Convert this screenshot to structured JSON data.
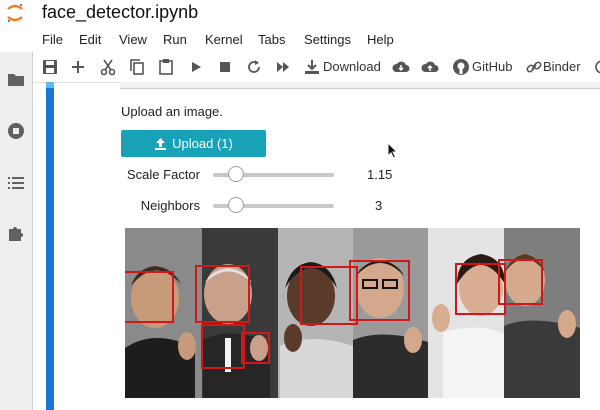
{
  "app": {
    "notebook_title": "face_detector.ipynb"
  },
  "menu": [
    "File",
    "Edit",
    "View",
    "Run",
    "Kernel",
    "Tabs",
    "Settings",
    "Help"
  ],
  "toolbar": {
    "download_label": "Download",
    "github_label": "GitHub",
    "binder_label": "Binder"
  },
  "cell": {
    "prompt": "Upload an image.",
    "upload_label": "Upload (1)",
    "scale_factor": {
      "label": "Scale Factor",
      "value": "1.15",
      "fraction": 0.14
    },
    "neighbors": {
      "label": "Neighbors",
      "value": "3",
      "fraction": 0.14
    }
  },
  "image": {
    "description_icons": [
      "detected-face-box"
    ],
    "face_count": 6
  },
  "colors": {
    "accent": "#17a2b8",
    "cell_bar": "#1976d2",
    "box": "#d01818"
  }
}
